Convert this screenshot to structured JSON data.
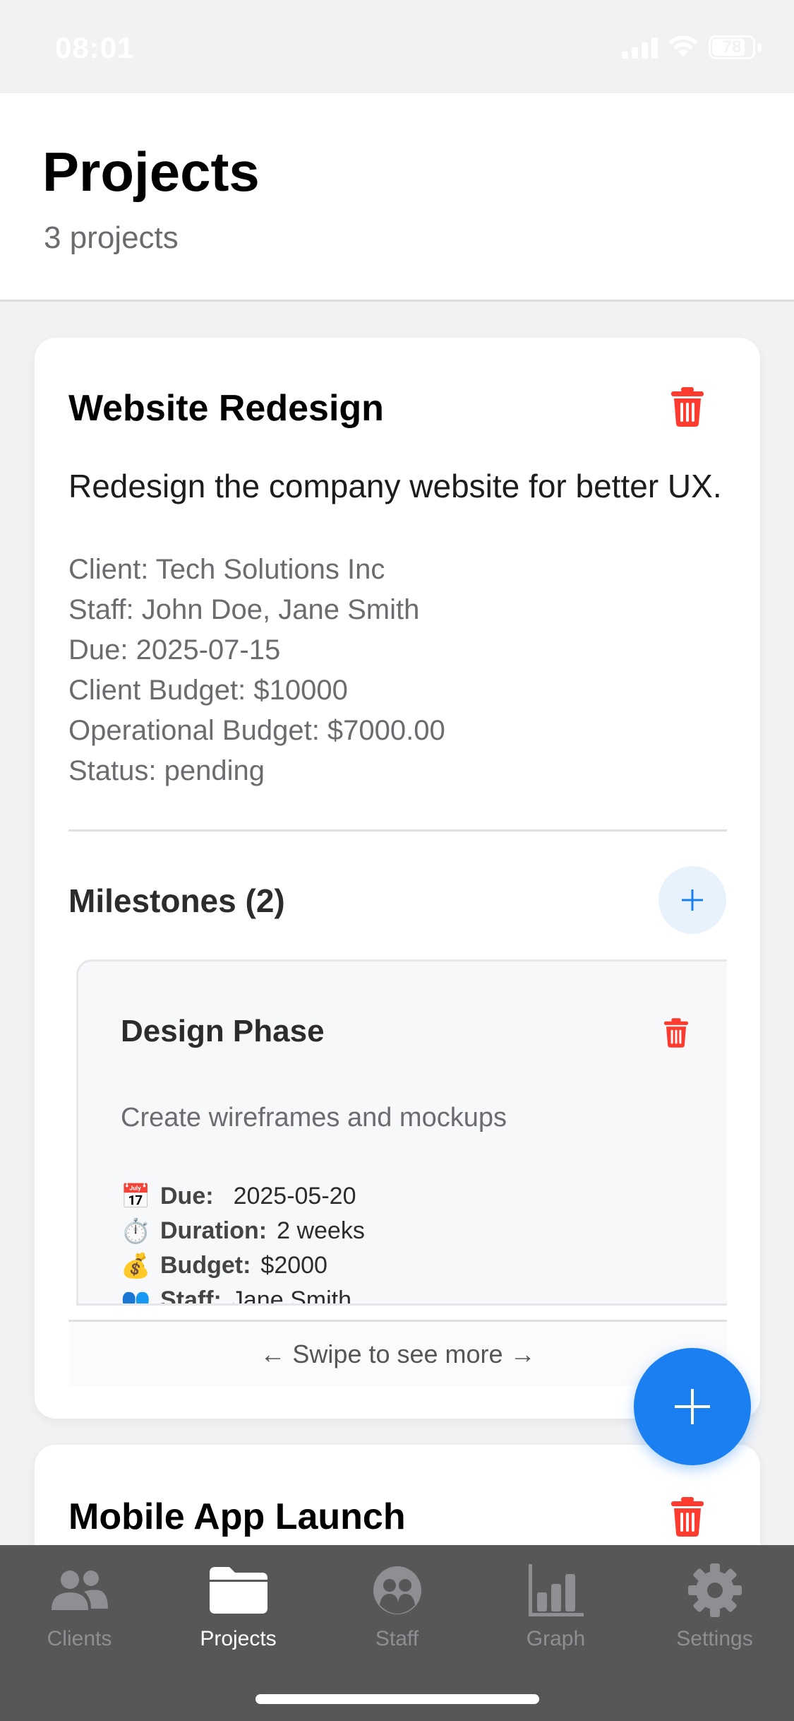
{
  "status_bar": {
    "time": "08:01",
    "battery": "78"
  },
  "header": {
    "title": "Projects",
    "subtitle": "3 projects"
  },
  "projects": [
    {
      "title": "Website Redesign",
      "description": "Redesign the company website for better UX.",
      "meta": [
        "Client: Tech Solutions Inc",
        "Staff: John Doe, Jane Smith",
        "Due: 2025-07-15",
        "Client Budget: $10000",
        "Operational Budget: $7000.00",
        "Status: pending"
      ],
      "milestones_title": "Milestones (2)",
      "milestone": {
        "title": "Design Phase",
        "description": "Create wireframes and mockups",
        "details": [
          {
            "emoji": "📅",
            "label": "Due:",
            "value": "2025-05-20"
          },
          {
            "emoji": "⏱️",
            "label": "Duration:",
            "value": "2 weeks"
          },
          {
            "emoji": "💰",
            "label": "Budget:",
            "value": "$2000"
          },
          {
            "emoji": "👥",
            "label": "Staff:",
            "value": "Jane Smith"
          }
        ]
      },
      "swipe_hint": "← Swipe to see more →"
    },
    {
      "title": "Mobile App Launch"
    }
  ],
  "icons": {
    "delete": "trash-icon",
    "add": "plus-icon"
  },
  "colors": {
    "accent": "#1a7ff0",
    "danger": "#ff3b30",
    "tabbar": "#575757"
  },
  "tabs": [
    {
      "label": "Clients",
      "icon": "people-icon"
    },
    {
      "label": "Projects",
      "icon": "folder-icon",
      "active": true
    },
    {
      "label": "Staff",
      "icon": "staff-icon"
    },
    {
      "label": "Graph",
      "icon": "bar-chart-icon"
    },
    {
      "label": "Settings",
      "icon": "gear-icon"
    }
  ]
}
